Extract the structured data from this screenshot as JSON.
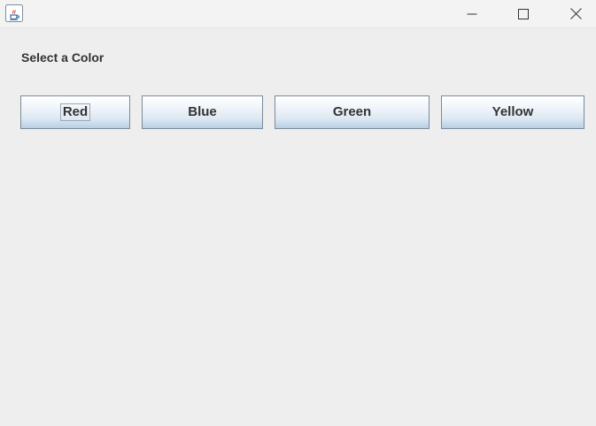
{
  "window": {
    "title": "",
    "controls": {
      "minimize_icon": "minimize-icon",
      "maximize_icon": "maximize-icon",
      "close_icon": "close-icon"
    }
  },
  "panel": {
    "heading": "Select a Color",
    "buttons": [
      {
        "label": "Red"
      },
      {
        "label": "Blue"
      },
      {
        "label": "Green"
      },
      {
        "label": "Yellow"
      }
    ],
    "focused_button": "Red"
  },
  "colors": {
    "background": "#eeeeee",
    "titlebar": "#f3f3f3",
    "text": "#333333",
    "button_border": "#7a8a99"
  }
}
